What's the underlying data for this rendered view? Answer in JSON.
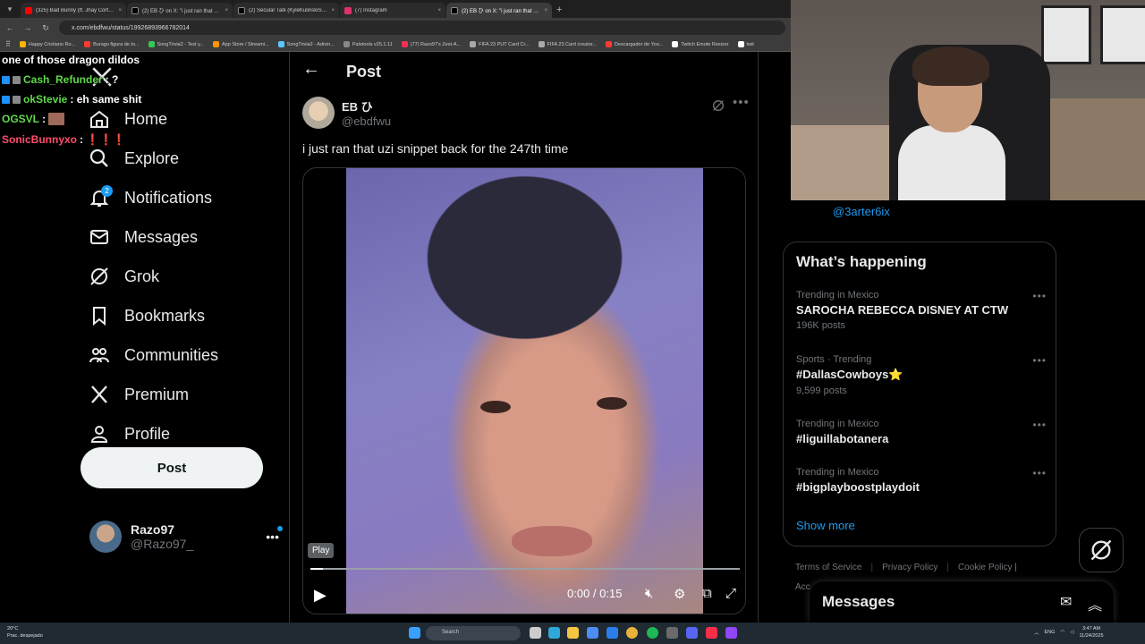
{
  "browser": {
    "tabs": [
      {
        "title": "(325) Bad Bunny (ft. Jhay Cortez...",
        "color": "#ff0000"
      },
      {
        "title": "(2) EB ひ on X: \"i just ran that u...",
        "color": "#ffffff"
      },
      {
        "title": "(2) Secular Talk (KyleKulinskiSh...",
        "color": "#ffffff"
      },
      {
        "title": "(7) Instagram",
        "color": "#e1306c"
      },
      {
        "title": "(2) EB ひ on X: \"i just ran that u...",
        "color": "#ffffff"
      }
    ],
    "url": "x.com/ebdfwu/status/1992689396678201​4",
    "bookmarks": [
      "Happy Cristiano Ro...",
      "Burago figura de to...",
      "SongTrivia2 - Test y...",
      "App Store / Streami...",
      "SongTrivia2 - Adivin...",
      "Paletools v25.1.11",
      "(77) Razo97's Zest-A...",
      "FIFA 23 PUT Card Cr...",
      "FIFA 23 Card creator...",
      "Descargador de Yoo...",
      "Twitch Emote Resizer",
      "twit"
    ]
  },
  "chat": [
    {
      "user": "",
      "message": "one of those dragon dildos",
      "color": "#ffffff"
    },
    {
      "user": "Cash_Refunder",
      "message": ": ?",
      "color": "#5fd94a"
    },
    {
      "user": "okStevie",
      "message": ": eh same shit",
      "color": "#5fd94a"
    },
    {
      "user": "OGSVL",
      "message": ":",
      "color": "#5fd94a"
    },
    {
      "user": "SonicBunnyxo",
      "message": ":",
      "color": "#ff4d6d"
    }
  ],
  "sidebar": {
    "items": [
      {
        "label": "Home",
        "icon": "home-icon"
      },
      {
        "label": "Explore",
        "icon": "search-icon"
      },
      {
        "label": "Notifications",
        "icon": "bell-icon",
        "badge": "2"
      },
      {
        "label": "Messages",
        "icon": "envelope-icon"
      },
      {
        "label": "Grok",
        "icon": "grok-icon"
      },
      {
        "label": "Bookmarks",
        "icon": "bookmark-icon"
      },
      {
        "label": "Communities",
        "icon": "communities-icon"
      },
      {
        "label": "Premium",
        "icon": "x-logo-icon"
      },
      {
        "label": "Profile",
        "icon": "person-icon"
      },
      {
        "label": "More",
        "icon": "more-circle-icon"
      }
    ],
    "post_button": "Post",
    "account": {
      "name": "Razo97",
      "handle": "@Razo97_"
    }
  },
  "post": {
    "header": "Post",
    "author_name": "EB ひ",
    "author_handle": "@ebdfwu",
    "text": "i just ran that uzi snippet back for the 247th time",
    "video": {
      "tooltip": "Play",
      "time": "0:00 / 0:15",
      "progress": 0.03
    }
  },
  "right": {
    "handle": "@3arter6ix",
    "trends_title": "What’s happening",
    "trends": [
      {
        "meta": "Trending in Mexico",
        "name": "SAROCHA REBECCA DISNEY AT CTW",
        "count": "196K posts"
      },
      {
        "meta": "Sports · Trending",
        "name": "#DallasCowboys⭐",
        "count": "9,599 posts"
      },
      {
        "meta": "Trending in Mexico",
        "name": "#liguillabotanera",
        "count": ""
      },
      {
        "meta": "Trending in Mexico",
        "name": "#bigplayboostplaydoit",
        "count": ""
      }
    ],
    "show_more": "Show more",
    "footer": [
      "Terms of Service",
      "Privacy Policy",
      "Cookie Policy |"
    ],
    "footer2": "Acc",
    "messages_title": "Messages"
  },
  "taskbar": {
    "weather_temp": "20°C",
    "weather_desc": "Prac. despejado",
    "search": "Search",
    "lang": "ENG",
    "time": "3:47 AM",
    "date": "11/24/2025"
  },
  "colors": {
    "accent": "#1d9bf0",
    "background": "#000000",
    "border": "#2f3336",
    "muted": "#71767b"
  }
}
